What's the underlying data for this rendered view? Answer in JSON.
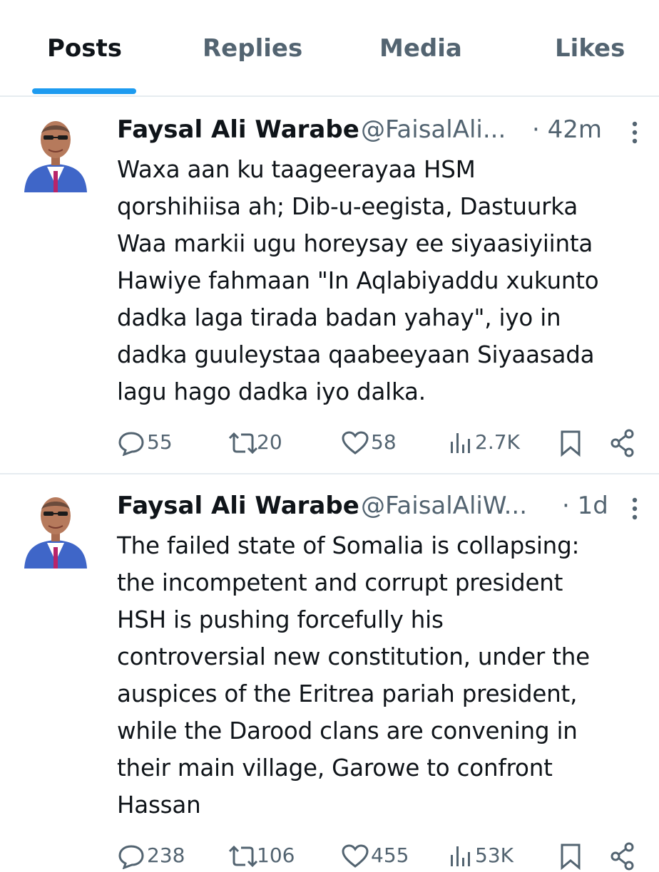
{
  "tabs": [
    "Posts",
    "Replies",
    "Media",
    "Likes"
  ],
  "active_tab": "Posts",
  "accent_color": "#1d9bf0",
  "tweets": [
    {
      "name": "Faysal Ali Warabe",
      "handle": "@FaisalAli...",
      "time": "· 42m",
      "text": "Waxa aan ku taageerayaa  HSM\nqorshihiisa ah; Dib-u-eegista, Dastuurka\nWaa markii ugu horeysay ee siyaasiyiinta\nHawiye fahmaan \"In Aqlabiyaddu xukunto\ndadka laga tirada badan yahay\", iyo in\ndadka guuleystaa qaabeeyaan Siyaasada\nlagu hago dadka iyo dalka.",
      "replies": "55",
      "reposts": "20",
      "likes": "58",
      "views": "2.7K"
    },
    {
      "name": "Faysal Ali Warabe",
      "handle": "@FaisalAliW...",
      "time": "· 1d",
      "text": "The failed state of Somalia is collapsing:\nthe incompetent and corrupt president\nHSH is pushing forcefully his\ncontroversial new constitution, under the\nauspices of the Eritrea pariah president,\nwhile the Darood clans are convening in\ntheir main village, Garowe to confront\nHassan",
      "replies": "238",
      "reposts": "106",
      "likes": "455",
      "views": "53K"
    }
  ]
}
